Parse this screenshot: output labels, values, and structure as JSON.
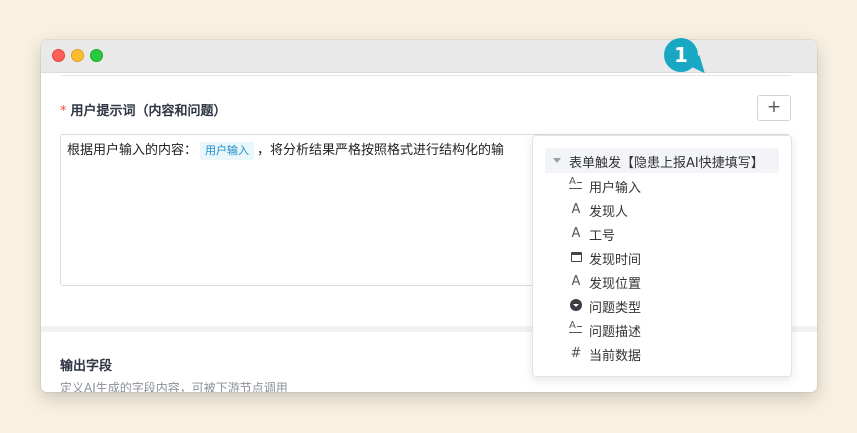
{
  "form": {
    "prompt_label": "用户提示词（内容和问题）",
    "required_mark": "*",
    "add_button": "+",
    "callout_number": "1",
    "prompt_before": "根据用户输入的内容：",
    "prompt_chip": "用户输入",
    "prompt_after": "，将分析结果严格按照格式进行结构化的输",
    "output_title": "输出字段",
    "output_desc": "定义AI生成的字段内容，可被下游节点调用"
  },
  "dropdown": {
    "group_title": "表单触发【隐患上报AI快捷填写】",
    "items": [
      {
        "label": "用户输入",
        "icon": "text-lines-icon"
      },
      {
        "label": "发现人",
        "icon": "text-a-icon"
      },
      {
        "label": "工号",
        "icon": "text-a-icon"
      },
      {
        "label": "发现时间",
        "icon": "calendar-icon"
      },
      {
        "label": "发现位置",
        "icon": "text-a-icon"
      },
      {
        "label": "问题类型",
        "icon": "select-icon"
      },
      {
        "label": "问题描述",
        "icon": "text-lines-icon"
      },
      {
        "label": "当前数据",
        "icon": "hash-icon"
      }
    ]
  },
  "colors": {
    "accent": "#19a8c4",
    "required": "#f5483b",
    "chip_text": "#1c8fc4",
    "background": "#f8f0e0"
  }
}
